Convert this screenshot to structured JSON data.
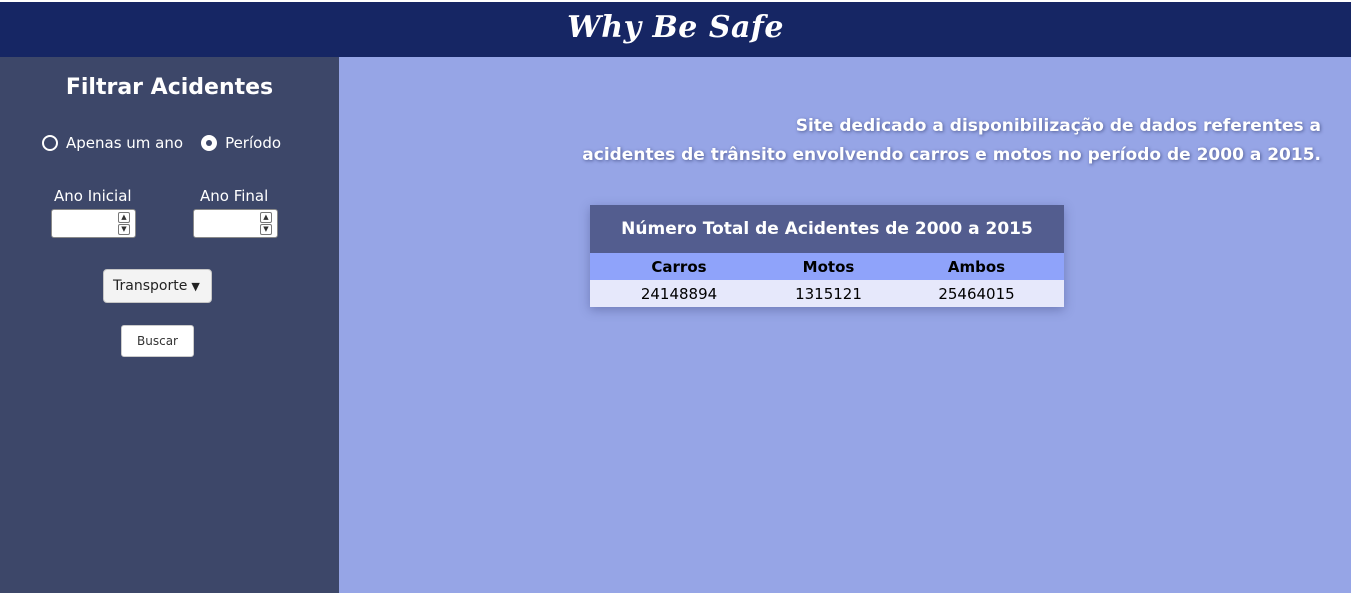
{
  "header": {
    "title": "Why Be Safe"
  },
  "sidebar": {
    "title": "Filtrar Acidentes",
    "radios": [
      {
        "label": "Apenas um ano",
        "checked": false
      },
      {
        "label": "Período",
        "checked": true
      }
    ],
    "ano_inicial_label": "Ano Inicial",
    "ano_final_label": "Ano Final",
    "ano_inicial_value": "",
    "ano_final_value": "",
    "select_value": "Transporte",
    "search_button": "Buscar"
  },
  "main": {
    "intro_line1": "Site dedicado a disponibilização de dados referentes a",
    "intro_line2": "acidentes de trânsito envolvendo carros e motos no período de 2000 a 2015.",
    "table": {
      "caption": "Número Total de Acidentes de 2000 a 2015",
      "columns": [
        "Carros",
        "Motos",
        "Ambos"
      ],
      "rows": [
        [
          "24148894",
          "1315121",
          "25464015"
        ]
      ]
    }
  },
  "colors": {
    "header_bg": "#162664",
    "sidebar_bg": "#3d4769",
    "main_bg": "#96a5e6",
    "table_caption_bg": "#535d8f",
    "table_head_bg": "#8fa3fa",
    "table_row_bg": "#e6e8fb"
  },
  "icons": [
    "radio-unchecked-icon",
    "radio-checked-icon",
    "spin-up-icon",
    "spin-down-icon",
    "chevron-down-icon"
  ]
}
